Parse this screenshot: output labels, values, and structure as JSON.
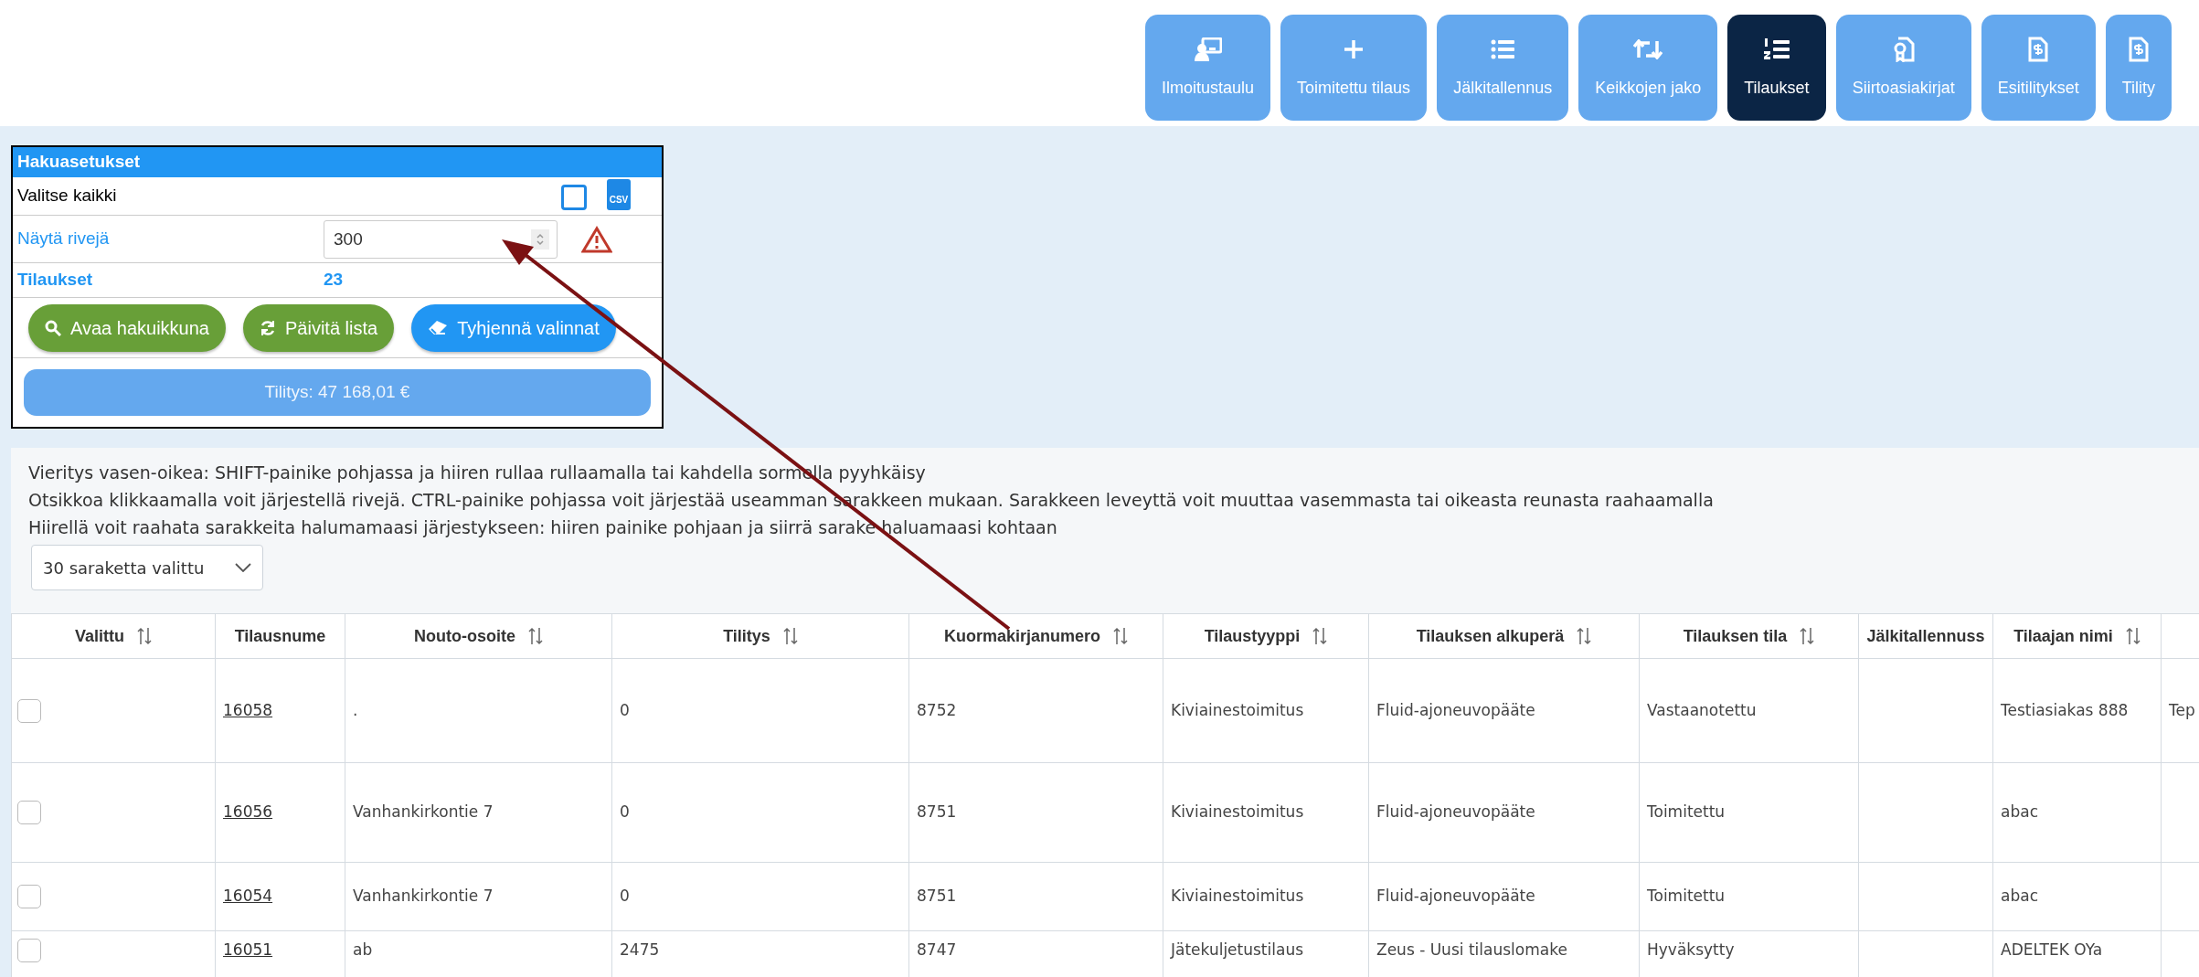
{
  "nav": [
    {
      "label": "Ilmoitustaulu",
      "selected": false
    },
    {
      "label": "Toimitettu tilaus",
      "selected": false
    },
    {
      "label": "Jälkitallennus",
      "selected": false
    },
    {
      "label": "Keikkojen jako",
      "selected": false
    },
    {
      "label": "Tilaukset",
      "selected": true
    },
    {
      "label": "Siirtoasiakirjat",
      "selected": false
    },
    {
      "label": "Esitilitykset",
      "selected": false
    },
    {
      "label": "Tility",
      "selected": false
    }
  ],
  "search_panel": {
    "title": "Hakuasetukset",
    "select_all": {
      "label": "Valitse kaikki",
      "checked": false,
      "export_label": "CSV"
    },
    "rows_field": {
      "label": "Näytä rivejä",
      "value": "300",
      "warning": true
    },
    "orders": {
      "label": "Tilaukset",
      "count": "23"
    },
    "buttons": [
      {
        "label": "Avaa hakuikkuna",
        "kind": "green"
      },
      {
        "label": "Päivitä lista",
        "kind": "green"
      },
      {
        "label": "Tyhjennä valinnat",
        "kind": "blue"
      }
    ],
    "total": "Tilitys: 47 168,01 €"
  },
  "instructions": [
    "Vieritys vasen-oikea: SHIFT-painike pohjassa ja hiiren rullaa rullaamalla tai kahdella sormella pyyhkäisy",
    "Otsikkoa klikkaamalla voit järjestellä rivejä. CTRL-painike pohjassa voit järjestää useamman sarakkeen mukaan. Sarakkeen leveyttä voit muuttaa vasemmasta tai oikeasta reunasta raahaamalla",
    "Hiirellä voit raahata sarakkeita halumamaasi järjestykseen: hiiren painike pohjaan ja siirrä sarake haluamaasi kohtaan"
  ],
  "column_select": "30 saraketta valittu",
  "table": {
    "columns": [
      {
        "label": "Valittu",
        "sortable": true
      },
      {
        "label": "Tilausnume",
        "sortable": false
      },
      {
        "label": "Nouto-osoite",
        "sortable": true
      },
      {
        "label": "Tilitys",
        "sortable": true
      },
      {
        "label": "Kuormakirjanumero",
        "sortable": true
      },
      {
        "label": "Tilaustyyppi",
        "sortable": true
      },
      {
        "label": "Tilauksen alkuperä",
        "sortable": true
      },
      {
        "label": "Tilauksen tila",
        "sortable": true
      },
      {
        "label": "Jälkitallennuss",
        "sortable": false
      },
      {
        "label": "Tilaajan nimi",
        "sortable": true
      }
    ],
    "rows": [
      {
        "selected": false,
        "cells": [
          "",
          "16058",
          ".",
          "0",
          "8752",
          "Kiviainestoimitus",
          "Fluid-ajoneuvopääte",
          "Vastaanotettu",
          "",
          "Testiasiakas 888",
          "Tep"
        ]
      },
      {
        "selected": false,
        "cells": [
          "",
          "16056",
          "Vanhankirkontie 7",
          "0",
          "8751",
          "Kiviainestoimitus",
          "Fluid-ajoneuvopääte",
          "Toimitettu",
          "",
          "abac",
          ""
        ]
      },
      {
        "selected": false,
        "cells": [
          "",
          "16054",
          "Vanhankirkontie 7",
          "0",
          "8751",
          "Kiviainestoimitus",
          "Fluid-ajoneuvopääte",
          "Toimitettu",
          "",
          "abac",
          ""
        ]
      },
      {
        "selected": false,
        "cells": [
          "",
          "16051",
          "ab",
          "2475",
          "8747",
          "Jätekuljetustilaus",
          "Zeus - Uusi tilauslomake",
          "Hyväksytty",
          "",
          "ADELTEK OYa",
          ""
        ]
      }
    ]
  }
}
